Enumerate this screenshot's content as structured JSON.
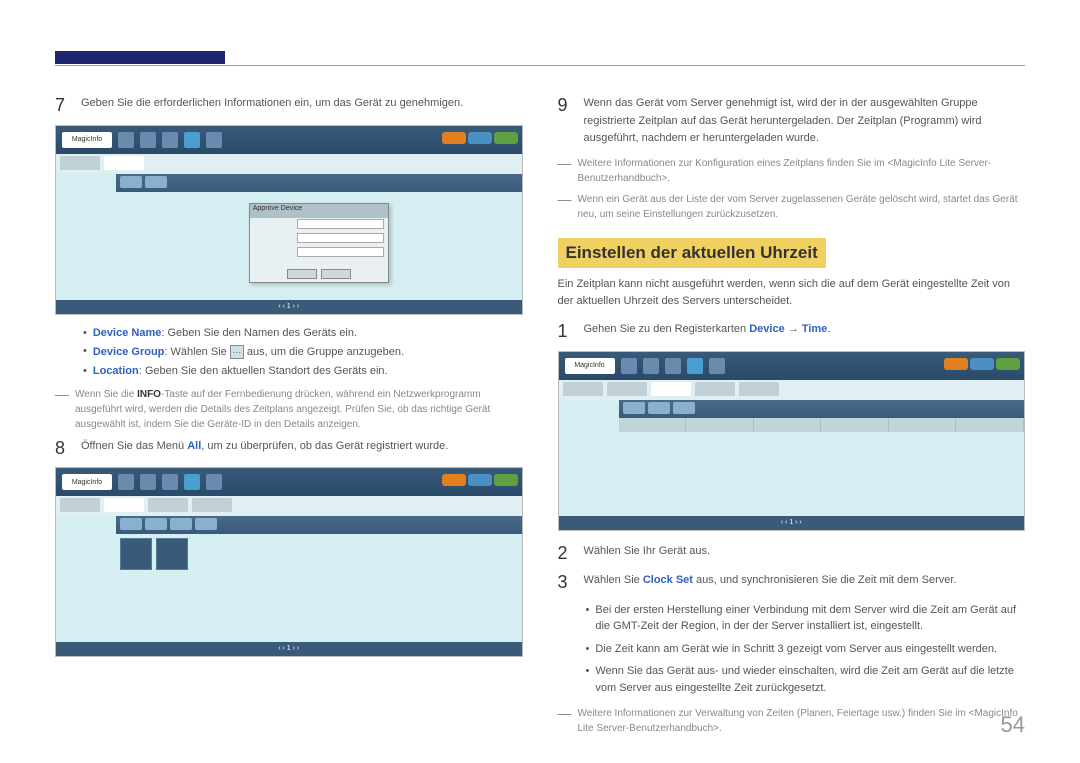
{
  "page_number": "54",
  "left": {
    "step7": "Geben Sie die erforderlichen Informationen ein, um das Gerät zu genehmigen.",
    "bullets": {
      "device_name_label": "Device Name",
      "device_name_text": ": Geben Sie den Namen des Geräts ein.",
      "device_group_label": "Device Group",
      "device_group_prefix": ": Wählen Sie ",
      "device_group_suffix": " aus, um die Gruppe anzugeben.",
      "icon_glyph": "···",
      "location_label": "Location",
      "location_text": ": Geben Sie den aktuellen Standort des Geräts ein."
    },
    "note7_pre": "Wenn Sie die ",
    "note7_info": "INFO",
    "note7_post": "-Taste auf der Fernbedienung drücken, während ein Netzwerkprogramm ausgeführt wird, werden die Details des Zeitplans angezeigt. Prüfen Sie, ob das richtige Gerät ausgewählt ist, indem Sie die Geräte-ID in den Details anzeigen.",
    "step8_pre": "Öffnen Sie das Menü ",
    "step8_all": "All",
    "step8_post": ", um zu überprüfen, ob das Gerät registriert wurde.",
    "ss_logo": "MagicInfo",
    "ss_modal_title": "Approve Device"
  },
  "right": {
    "step9": "Wenn das Gerät vom Server genehmigt ist, wird der in der ausgewählten Gruppe registrierte Zeitplan auf das Gerät heruntergeladen. Der Zeitplan (Programm) wird ausgeführt, nachdem er heruntergeladen wurde.",
    "note9a": "Weitere Informationen zur Konfiguration eines Zeitplans finden Sie im <MagicInfo Lite Server-Benutzerhandbuch>.",
    "note9b": "Wenn ein Gerät aus der Liste der vom Server zugelassenen Geräte gelöscht wird, startet das Gerät neu, um seine Einstellungen zurückzusetzen.",
    "heading": "Einstellen der aktuellen Uhrzeit",
    "intro": "Ein Zeitplan kann nicht ausgeführt werden, wenn sich die auf dem Gerät eingestellte Zeit von der aktuellen Uhrzeit des Servers unterscheidet.",
    "step1_pre": "Gehen Sie zu den Registerkarten ",
    "step1_device": "Device",
    "step1_arrow": " → ",
    "step1_time": "Time",
    "step1_post": ".",
    "step2": "Wählen Sie Ihr Gerät aus.",
    "step3_pre": "Wählen Sie ",
    "step3_clockset": "Clock Set",
    "step3_post": " aus, und synchronisieren Sie die Zeit mit dem Server.",
    "bullets": {
      "b1": "Bei der ersten Herstellung einer Verbindung mit dem Server wird die Zeit am Gerät auf die GMT-Zeit der Region, in der der Server installiert ist, eingestellt.",
      "b2": "Die Zeit kann am Gerät wie in Schritt 3 gezeigt vom Server aus eingestellt werden.",
      "b3": "Wenn Sie das Gerät aus- und wieder einschalten, wird die Zeit am Gerät auf die letzte vom Server aus eingestellte Zeit zurückgesetzt."
    },
    "note_final": "Weitere Informationen zur Verwaltung von Zeiten (Planen, Feiertage usw.) finden Sie im <MagicInfo Lite Server-Benutzerhandbuch>."
  }
}
